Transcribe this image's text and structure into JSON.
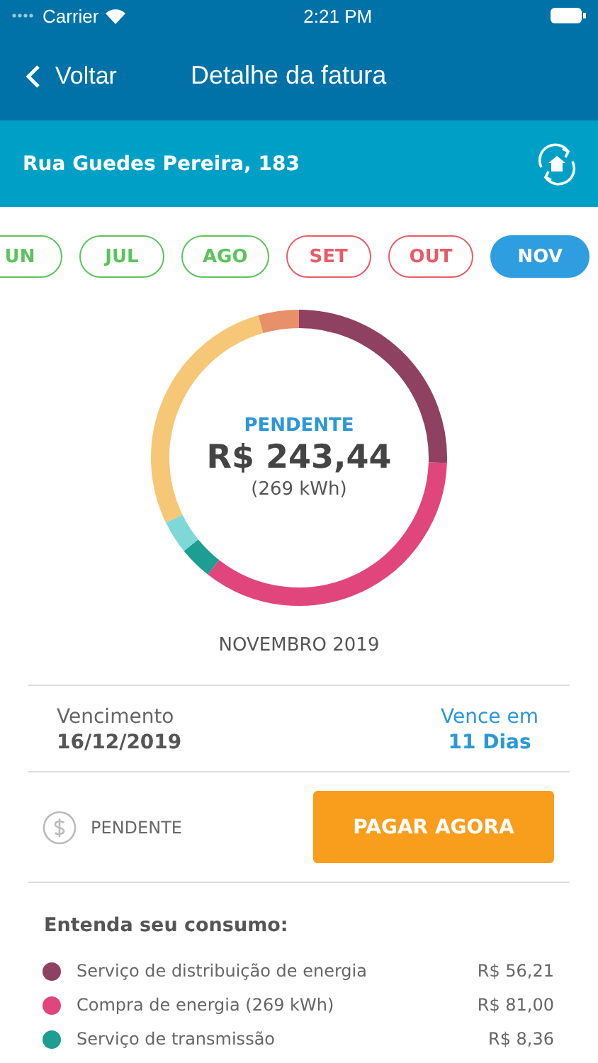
{
  "status_bar": {
    "carrier": "Carrier",
    "time": "2:21 PM"
  },
  "nav": {
    "back": "Voltar",
    "title": "Detalhe da fatura"
  },
  "address": {
    "text": "Rua Guedes Pereira, 183"
  },
  "months": [
    {
      "label": "UN",
      "color": "#5cc45c",
      "selected": false
    },
    {
      "label": "JUL",
      "color": "#5cc45c",
      "selected": false
    },
    {
      "label": "AGO",
      "color": "#5cc45c",
      "selected": false
    },
    {
      "label": "SET",
      "color": "#e85c68",
      "selected": false
    },
    {
      "label": "OUT",
      "color": "#e85c68",
      "selected": false
    },
    {
      "label": "NOV",
      "color": "#2f9ee0",
      "selected": true
    }
  ],
  "summary": {
    "status": "PENDENTE",
    "amount": "R$ 243,44",
    "consumption": "(269 kWh)",
    "period": "NOVEMBRO 2019"
  },
  "due": {
    "label": "Vencimento",
    "date": "16/12/2019",
    "countdown_label": "Vence em",
    "countdown": "11 Dias"
  },
  "payment": {
    "status": "PENDENTE",
    "button": "PAGAR AGORA"
  },
  "breakdown": {
    "title": "Entenda seu consumo:",
    "items": [
      {
        "name": "Serviço de distribuição de energia",
        "amount": "R$ 56,21",
        "color": "#8e4160"
      },
      {
        "name": "Compra de energia (269 kWh)",
        "amount": "R$ 81,00",
        "color": "#e0467c"
      },
      {
        "name": "Serviço de transmissão",
        "amount": "R$ 8,36",
        "color": "#1e9d92"
      }
    ]
  }
}
